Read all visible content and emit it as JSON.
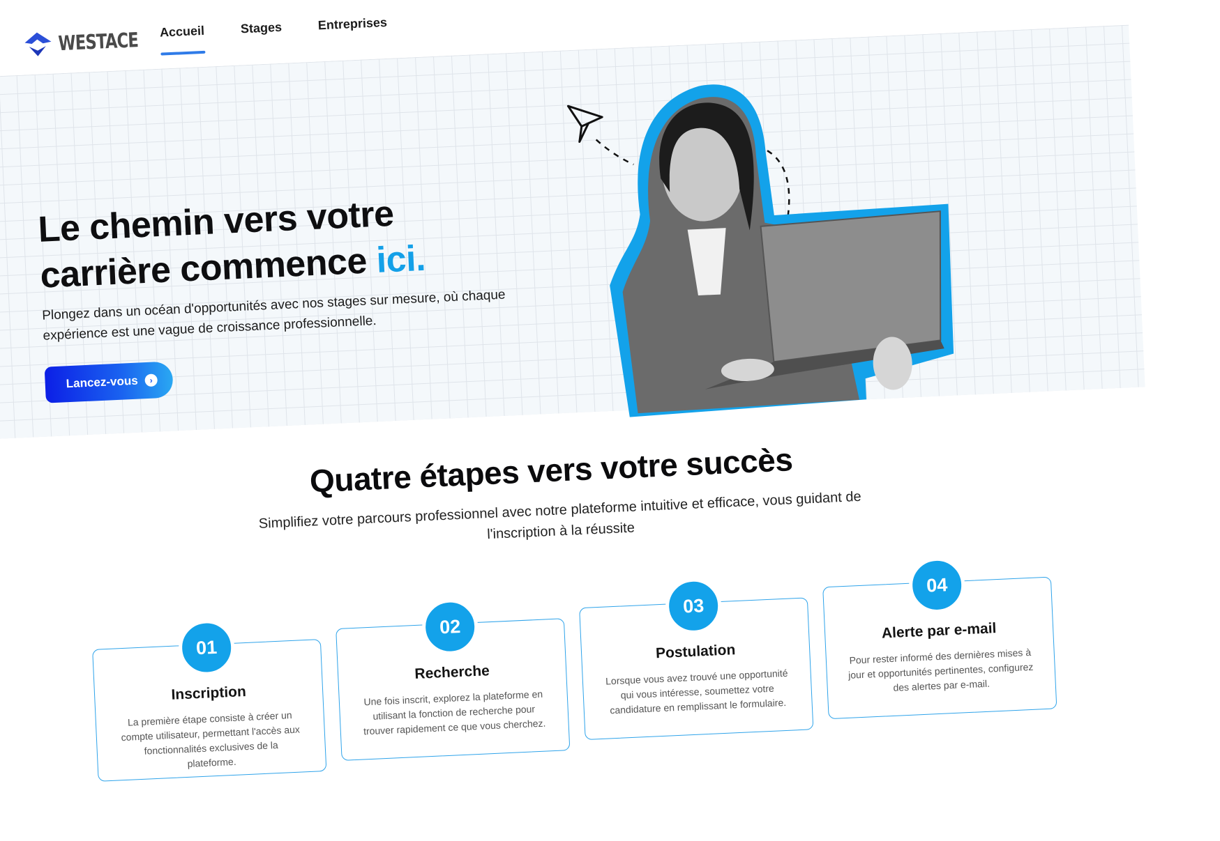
{
  "brand": {
    "name": "WESTACE"
  },
  "nav": [
    {
      "label": "Accueil",
      "active": true
    },
    {
      "label": "Stages",
      "active": false
    },
    {
      "label": "Entreprises",
      "active": false
    }
  ],
  "hero": {
    "title_line1": "Le chemin vers votre",
    "title_line2": "carrière commence ",
    "title_accent": "ici.",
    "subtitle": "Plongez dans un océan d'opportunités avec nos stages sur mesure, où chaque expérience est une vague de croissance professionnelle.",
    "cta_label": "Lancez-vous"
  },
  "steps": {
    "title": "Quatre étapes vers votre succès",
    "subtitle": "Simplifiez votre parcours professionnel avec notre plateforme intuitive et efficace, vous guidant de l'inscription à la réussite",
    "items": [
      {
        "number": "01",
        "title": "Inscription",
        "text": "La première étape consiste à créer un compte utilisateur, permettant l'accès aux fonctionnalités exclusives de la plateforme."
      },
      {
        "number": "02",
        "title": "Recherche",
        "text": "Une fois inscrit, explorez la plateforme en utilisant la fonction de recherche pour trouver rapidement ce que vous cherchez."
      },
      {
        "number": "03",
        "title": "Postulation",
        "text": "Lorsque vous avez trouvé une opportunité qui vous intéresse, soumettez votre candidature en remplissant le formulaire."
      },
      {
        "number": "04",
        "title": "Alerte par e-mail",
        "text": "Pour rester informé des dernières mises à jour et opportunités pertinentes, configurez des alertes par e-mail."
      }
    ]
  },
  "colors": {
    "accent": "#14a0e8",
    "cta_start": "#0c1fe6",
    "cta_end": "#2aa8f2",
    "nav_underline": "#2f7be8"
  },
  "icons": {
    "cta": "chevron-right-circle-icon",
    "illustration": "paper-plane-icon"
  }
}
